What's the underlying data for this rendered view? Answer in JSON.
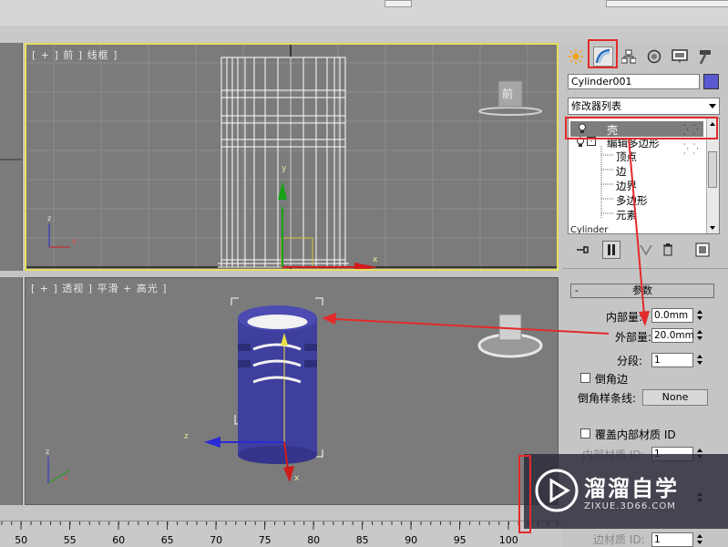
{
  "viewports": {
    "front": {
      "label": "[ + ] 前 ] 线框 ]",
      "cube_label": "前",
      "axis_x": "x",
      "axis_y": "y",
      "axis_z": "z"
    },
    "perspective": {
      "label": "[ + ] 透视 ] 平滑 + 高光 ]",
      "axis_x": "x",
      "axis_z": "z"
    }
  },
  "command_panel": {
    "tabs": [
      {
        "name": "create-tab",
        "icon": "sun-star-icon"
      },
      {
        "name": "modify-tab",
        "icon": "modify-arc-icon",
        "selected": true
      },
      {
        "name": "hierarchy-tab",
        "icon": "hierarchy-icon"
      },
      {
        "name": "motion-tab",
        "icon": "motion-ring-icon"
      },
      {
        "name": "display-tab",
        "icon": "display-monitor-icon"
      },
      {
        "name": "utilities-tab",
        "icon": "hammer-icon"
      }
    ],
    "object_name": "Cylinder001",
    "object_color": "#5a5ad0",
    "modifier_list": "修改器列表",
    "stack": {
      "shell": "壳",
      "edit_poly": "编辑多边形",
      "sub_levels": [
        "顶点",
        "边",
        "边界",
        "多边形",
        "元素"
      ],
      "base": "Cylinder"
    }
  },
  "parameters": {
    "title": "参数",
    "collapse": "-",
    "inner_amount_label": "内部量:",
    "inner_amount": "0.0mm",
    "outer_amount_label": "外部量:",
    "outer_amount": "20.0mm",
    "segments_label": "分段:",
    "segments": "1",
    "bevel_edges_label": "倒角边",
    "bevel_spline_label": "倒角样条线:",
    "bevel_spline_value": "None",
    "override_inner_mat_label": "覆盖内部材质 ID",
    "inner_mat_id_label": "内部材质 ID:",
    "inner_mat_id": "1",
    "edge_mat_id_label": "边材质 ID:",
    "edge_mat_id": "1"
  },
  "ruler": {
    "ticks": [
      "50",
      "55",
      "60",
      "65",
      "70",
      "75",
      "80",
      "85",
      "90",
      "95",
      "100"
    ]
  },
  "watermark": {
    "title": "溜溜自学",
    "subtitle": "ZIXUE.3D66.COM"
  },
  "colors": {
    "highlight_red": "#e32a2a",
    "active_viewport": "#e8e05a",
    "model_blue": "#3f3f9e"
  }
}
